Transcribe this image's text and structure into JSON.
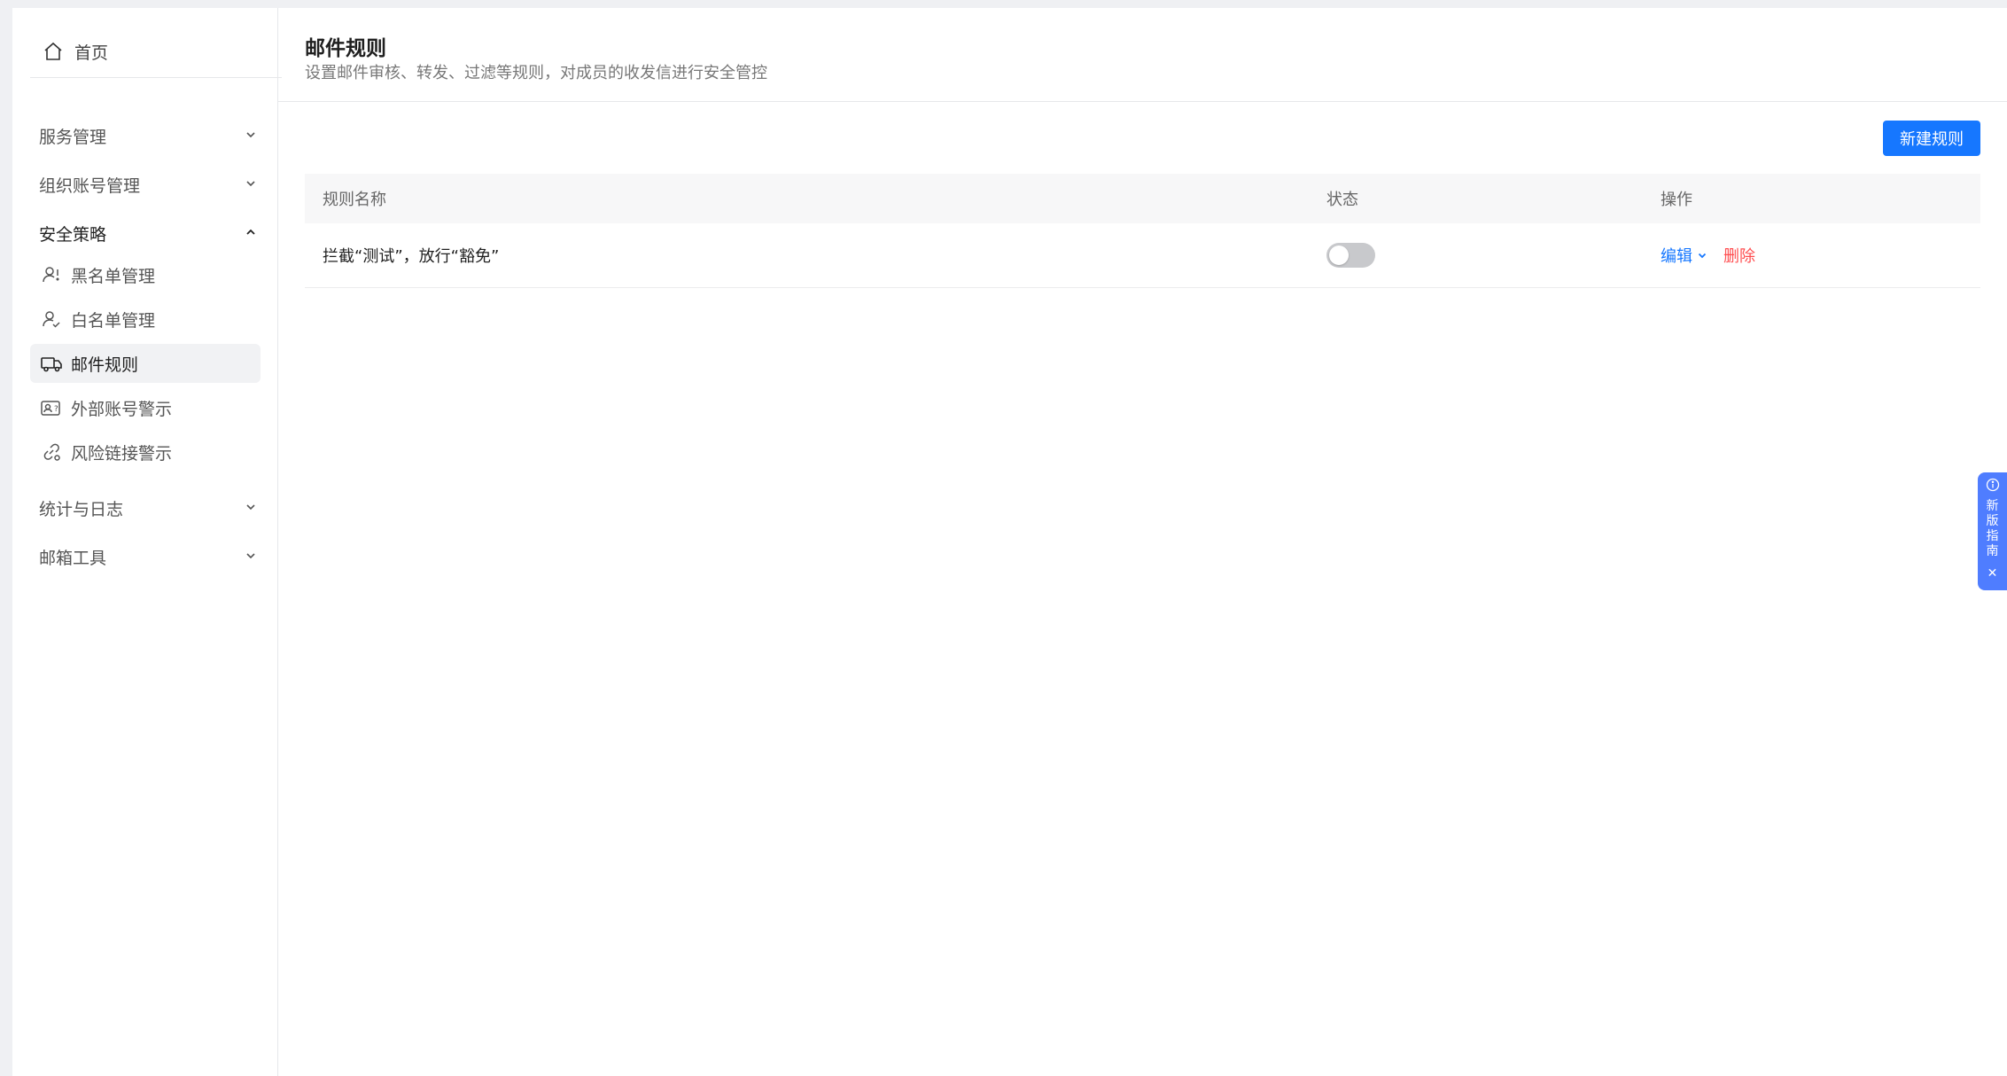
{
  "sidebar": {
    "home": {
      "label": "首页",
      "icon": "home-icon"
    },
    "groups": [
      {
        "label": "服务管理",
        "expanded": false
      },
      {
        "label": "组织账号管理",
        "expanded": false
      },
      {
        "label": "安全策略",
        "expanded": true
      },
      {
        "label": "统计与日志",
        "expanded": false
      },
      {
        "label": "邮箱工具",
        "expanded": false
      }
    ],
    "security_items": [
      {
        "label": "黑名单管理",
        "icon": "user-block-icon"
      },
      {
        "label": "白名单管理",
        "icon": "user-check-icon"
      },
      {
        "label": "邮件规则",
        "icon": "truck-icon",
        "active": true
      },
      {
        "label": "外部账号警示",
        "icon": "external-account-icon"
      },
      {
        "label": "风险链接警示",
        "icon": "link-warning-icon"
      }
    ]
  },
  "header": {
    "title": "邮件规则",
    "description": "设置邮件审核、转发、过滤等规则，对成员的收发信进行安全管控"
  },
  "toolbar": {
    "new_rule_label": "新建规则"
  },
  "table": {
    "columns": [
      "规则名称",
      "状态",
      "操作"
    ],
    "rows": [
      {
        "name": "拦截“测试”，放行“豁免”",
        "enabled": false,
        "edit_label": "编辑",
        "delete_label": "删除"
      }
    ]
  },
  "guide": {
    "label": "新版指南"
  },
  "colors": {
    "primary": "#1677ff",
    "danger": "#ff4d4f",
    "guide": "#4f7dff"
  }
}
